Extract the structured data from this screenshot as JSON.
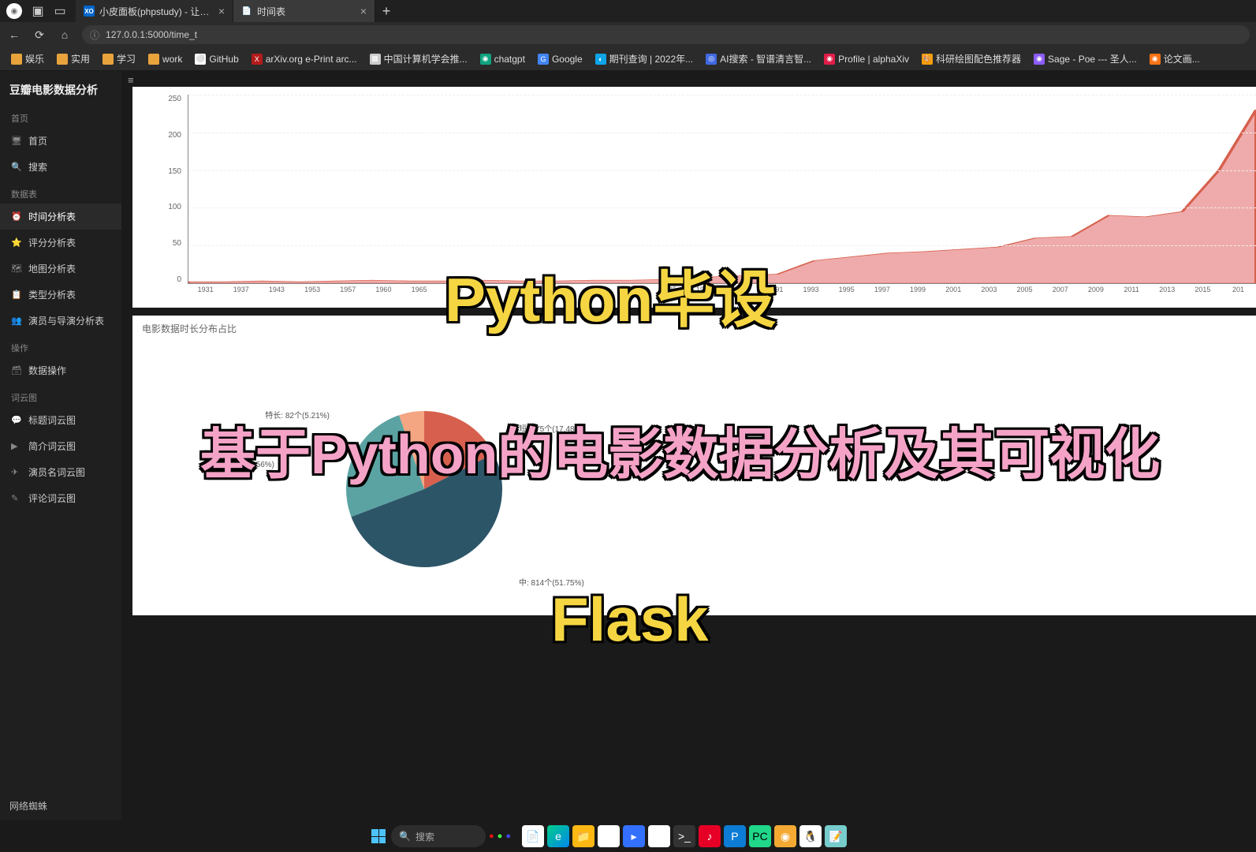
{
  "browser": {
    "tabs": [
      {
        "label": "小皮面板(phpstudy) - 让天下没有...",
        "favicon": "XO"
      },
      {
        "label": "时间表",
        "favicon": "📄"
      }
    ],
    "url": "127.0.0.1:5000/time_t",
    "bookmarks": [
      {
        "label": "娱乐",
        "type": "folder"
      },
      {
        "label": "实用",
        "type": "folder"
      },
      {
        "label": "学习",
        "type": "folder"
      },
      {
        "label": "work",
        "type": "folder"
      },
      {
        "label": "GitHub",
        "icon": "⚪",
        "color": "#fff"
      },
      {
        "label": "arXiv.org e-Print arc...",
        "icon": "X",
        "color": "#b31b1b"
      },
      {
        "label": "中国计算机学会推...",
        "icon": "▦",
        "color": "#ccc"
      },
      {
        "label": "chatgpt",
        "icon": "◉",
        "color": "#10a37f"
      },
      {
        "label": "Google",
        "icon": "G",
        "color": "#4285f4"
      },
      {
        "label": "期刊查询 | 2022年...",
        "icon": "◐",
        "color": "#0ea5e9"
      },
      {
        "label": "AI搜索 - 智谱清言智...",
        "icon": "◎",
        "color": "#4169e1"
      },
      {
        "label": "Profile | alphaXiv",
        "icon": "◉",
        "color": "#e11d48"
      },
      {
        "label": "科研绘图配色推荐器",
        "icon": "🎨",
        "color": "#f59e0b"
      },
      {
        "label": "Sage - Poe --- 圣人...",
        "icon": "◉",
        "color": "#8b5cf6"
      },
      {
        "label": "论文画...",
        "icon": "◉",
        "color": "#f97316"
      }
    ]
  },
  "app": {
    "title": "豆瓣电影数据分析",
    "sections": {
      "s1": {
        "label": "首页",
        "items": [
          {
            "icon": "🖥",
            "label": "首页"
          },
          {
            "icon": "🔍",
            "label": "搜索"
          }
        ]
      },
      "s2": {
        "label": "数据表",
        "items": [
          {
            "icon": "⏰",
            "label": "时间分析表",
            "active": true
          },
          {
            "icon": "⭐",
            "label": "评分分析表"
          },
          {
            "icon": "🗺",
            "label": "地图分析表"
          },
          {
            "icon": "📋",
            "label": "类型分析表"
          },
          {
            "icon": "👥",
            "label": "演员与导演分析表"
          }
        ]
      },
      "s3": {
        "label": "操作",
        "items": [
          {
            "icon": "🗃",
            "label": "数据操作"
          }
        ]
      },
      "s4": {
        "label": "词云图",
        "items": [
          {
            "icon": "💬",
            "label": "标题词云图"
          },
          {
            "icon": "▶",
            "label": "简介词云图"
          },
          {
            "icon": "✈",
            "label": "演员名词云图"
          },
          {
            "icon": "✎",
            "label": "评论词云图"
          }
        ]
      }
    },
    "footer": "网络蜘蛛"
  },
  "chart_data": [
    {
      "type": "area",
      "ylabel": "",
      "ylim": [
        0,
        250
      ],
      "yticks": [
        0,
        50,
        100,
        150,
        200,
        250
      ],
      "xticks": [
        "1931",
        "1937",
        "1943",
        "1953",
        "1957",
        "1960",
        "1965",
        "1967",
        "1972",
        "1975",
        "1978",
        "1980",
        "1983",
        "1985",
        "1987",
        "1989",
        "1991",
        "1993",
        "1995",
        "1997",
        "1999",
        "2001",
        "2003",
        "2005",
        "2007",
        "2009",
        "2011",
        "2013",
        "2015",
        "201"
      ],
      "series": [
        {
          "name": "count",
          "color": "#e88",
          "values": [
            2,
            2,
            3,
            2,
            3,
            4,
            3,
            3,
            4,
            3,
            3,
            4,
            4,
            5,
            8,
            10,
            12,
            30,
            35,
            40,
            42,
            45,
            48,
            60,
            62,
            90,
            88,
            95,
            150,
            230
          ]
        }
      ]
    },
    {
      "type": "pie",
      "title": "电影数据时长分布占比",
      "series": [
        {
          "name": "特长",
          "count": 82,
          "pct": 5.21,
          "color": "#f4a582",
          "label": "特长: 82个(5.21%)"
        },
        {
          "name": "短",
          "count": 275,
          "pct": 17.48,
          "color": "#d6604d",
          "label": "短: 275个(17.48%)"
        },
        {
          "name": "中",
          "count": 814,
          "pct": 51.75,
          "color": "#2d5568",
          "label": "中: 814个(51.75%)"
        },
        {
          "name": "长",
          "count": 402,
          "pct": 25.56,
          "color": "#5ba3a3",
          "label": "长: 402个(25.56%)"
        }
      ]
    }
  ],
  "overlays": {
    "line1": "Python毕设",
    "line2": "基于Python的电影数据分析及其可视化",
    "line3": "Flask"
  },
  "taskbar": {
    "search_placeholder": "搜索",
    "widget_text": ""
  }
}
